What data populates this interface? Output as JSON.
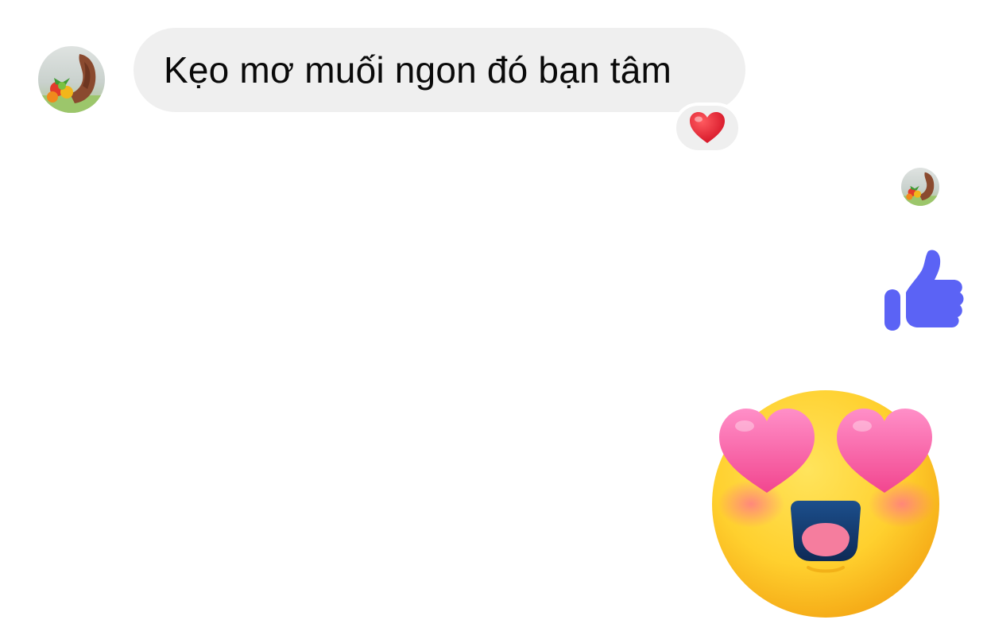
{
  "conversation": {
    "incoming_message": {
      "text": "Kẹo mơ muối ngon đó bạn tâm",
      "reaction": "red-heart-icon"
    },
    "outgoing": [
      {
        "type": "sticker",
        "icon": "thumbs-up-icon"
      },
      {
        "type": "sticker",
        "icon": "heart-eyes-emoji"
      }
    ]
  },
  "colors": {
    "bubble_background": "#efefef",
    "thumbs_up": "#5b63f5",
    "heart_reaction": "#e3172b"
  }
}
